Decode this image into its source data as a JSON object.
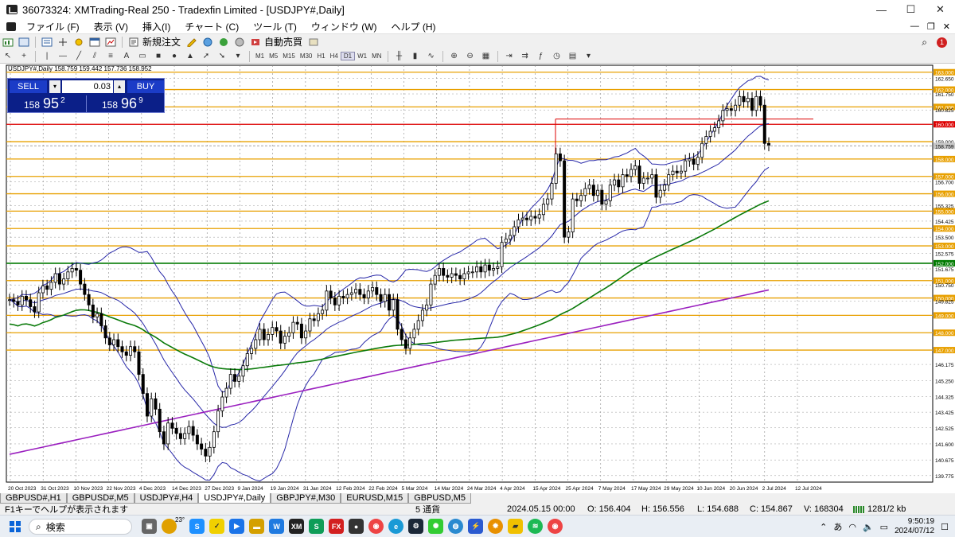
{
  "window": {
    "title": "36073324: XMTrading-Real 250 - Tradexfin Limited - [USDJPY#,Daily]",
    "minimize": "—",
    "maximize": "☐",
    "close": "✕"
  },
  "menu": {
    "items": [
      "ファイル (F)",
      "表示 (V)",
      "挿入(I)",
      "チャート (C)",
      "ツール (T)",
      "ウィンドウ (W)",
      "ヘルプ (H)"
    ],
    "notification_count": "1"
  },
  "toolbar": {
    "new_order_label": "新規注文",
    "auto_trading_label": "自動売買",
    "timeframes": [
      "M1",
      "M5",
      "M15",
      "M30",
      "H1",
      "H4",
      "D1",
      "W1",
      "MN"
    ]
  },
  "chart": {
    "info_line": "USDJPY#,Daily  158.759 159.442 157.736 158.952"
  },
  "trade_panel": {
    "sell_label": "SELL",
    "buy_label": "BUY",
    "lot": "0.03",
    "sell_prefix": "158",
    "sell_big": "95",
    "sell_sup": "2",
    "buy_prefix": "158",
    "buy_big": "96",
    "buy_sup": "9"
  },
  "chart_data": {
    "type": "candlestick",
    "symbol": "USDJPY#",
    "timeframe": "Daily",
    "ylim": [
      139.4,
      163.4
    ],
    "current_price": 158.759,
    "y_ticks": [
      "163.000",
      "162.650",
      "162.000",
      "161.750",
      "161.000",
      "160.825",
      "160.000",
      "159.000",
      "158.759",
      "158.000",
      "157.000",
      "156.700",
      "156.000",
      "155.325",
      "155.000",
      "154.425",
      "154.000",
      "153.500",
      "153.000",
      "152.575",
      "152.000",
      "151.675",
      "151.000",
      "150.750",
      "150.000",
      "149.825",
      "149.000",
      "148.000",
      "147.000",
      "146.175",
      "145.250",
      "144.325",
      "143.425",
      "142.525",
      "141.600",
      "140.675",
      "139.775"
    ],
    "highlighted_ticks": [
      "163.000",
      "162.000",
      "161.000",
      "160.000",
      "158.759",
      "158.000",
      "157.000",
      "156.000",
      "155.000",
      "154.000",
      "153.000",
      "152.000",
      "151.000",
      "150.000",
      "149.000",
      "148.000",
      "147.000"
    ],
    "x_ticks": [
      "20 Oct 2023",
      "31 Oct 2023",
      "10 Nov 2023",
      "22 Nov 2023",
      "4 Dec 2023",
      "14 Dec 2023",
      "27 Dec 2023",
      "9 Jan 2024",
      "19 Jan 2024",
      "31 Jan 2024",
      "12 Feb 2024",
      "22 Feb 2024",
      "5 Mar 2024",
      "14 Mar 2024",
      "24 Mar 2024",
      "4 Apr 2024",
      "15 Apr 2024",
      "25 Apr 2024",
      "7 May 2024",
      "17 May 2024",
      "29 May 2024",
      "10 Jun 2024",
      "20 Jun 2024",
      "2 Jul 2024",
      "12 Jul 2024"
    ],
    "horizontal_levels": [
      163,
      162,
      161,
      159,
      158,
      157,
      156,
      155,
      154,
      153,
      151,
      150,
      149,
      148,
      147
    ],
    "level_colors": {
      "orange": "#e8a000",
      "red": "#dd0000",
      "green": "#007a00",
      "grid": "#000000"
    },
    "red_level": 160,
    "green_level": 152,
    "closes": [
      149.9,
      149.8,
      149.6,
      150.1,
      149.9,
      149.5,
      149.2,
      150.3,
      150.7,
      150.5,
      150.9,
      151.4,
      150.8,
      151.1,
      151.5,
      151.7,
      151.6,
      150.8,
      150.2,
      149.6,
      148.9,
      149.1,
      148.4,
      147.7,
      147.3,
      147.6,
      147.2,
      146.9,
      146.7,
      147.2,
      146.9,
      145.6,
      144.5,
      143.2,
      144.2,
      143.6,
      142.3,
      141.6,
      142.8,
      142.5,
      142.2,
      141.9,
      142.2,
      142.6,
      142.1,
      141.6,
      141.3,
      140.9,
      141.4,
      142.3,
      143.5,
      144.3,
      144.8,
      145.6,
      145.2,
      145.5,
      146.1,
      146.8,
      147.1,
      147.6,
      148.2,
      147.6,
      147.9,
      148.3,
      148.1,
      147.4,
      147.8,
      148.0,
      148.6,
      148.5,
      147.7,
      148.1,
      148.8,
      148.7,
      149.1,
      149.3,
      150.4,
      150.0,
      149.6,
      150.1,
      150.0,
      150.2,
      150.3,
      150.5,
      150.2,
      150.0,
      150.4,
      150.6,
      150.2,
      149.8,
      150.2,
      149.3,
      149.9,
      148.2,
      147.6,
      147.1,
      147.7,
      148.2,
      148.7,
      149.3,
      149.6,
      150.8,
      151.3,
      151.7,
      151.3,
      151.2,
      151.4,
      151.3,
      151.1,
      151.4,
      151.5,
      151.5,
      151.8,
      151.5,
      151.9,
      151.6,
      151.7,
      151.8,
      153.2,
      153.4,
      153.6,
      154.1,
      154.5,
      154.6,
      154.5,
      154.7,
      154.6,
      154.8,
      155.4,
      155.7,
      156.6,
      158.3,
      157.9,
      153.5,
      153.8,
      155.7,
      155.6,
      155.9,
      156.3,
      156.5,
      155.9,
      156.2,
      155.4,
      155.6,
      156.5,
      156.8,
      156.4,
      157.1,
      157.0,
      157.4,
      157.6,
      156.6,
      156.9,
      156.9,
      157.1,
      155.8,
      156.2,
      156.5,
      157.1,
      157.3,
      157.2,
      157.3,
      157.9,
      158.0,
      157.7,
      158.1,
      158.9,
      159.3,
      159.6,
      159.8,
      160.2,
      160.8,
      160.9,
      160.8,
      161.1,
      161.6,
      161.3,
      161.5,
      160.8,
      161.6,
      161.1,
      158.9,
      158.8
    ]
  },
  "tabs": [
    "GBPUSD#,H1",
    "GBPUSD#,M5",
    "USDJPY#,H4",
    "USDJPY#,Daily",
    "GBPJPY#,M30",
    "EURUSD,M15",
    "GBPUSD,M5"
  ],
  "active_tab_index": 3,
  "status": {
    "help": "F1キーでヘルプが表示されます",
    "count": "5 通貨",
    "datetime": "2024.05.15 00:00",
    "open": "O: 156.404",
    "high": "H: 156.556",
    "low": "L: 154.688",
    "close": "C: 154.867",
    "volume": "V: 168304",
    "traffic": "1281/2 kb"
  },
  "taskbar": {
    "search_placeholder": "検索",
    "weather": "23°",
    "ime": "あ",
    "time": "9:50:19",
    "date": "2024/07/12"
  }
}
